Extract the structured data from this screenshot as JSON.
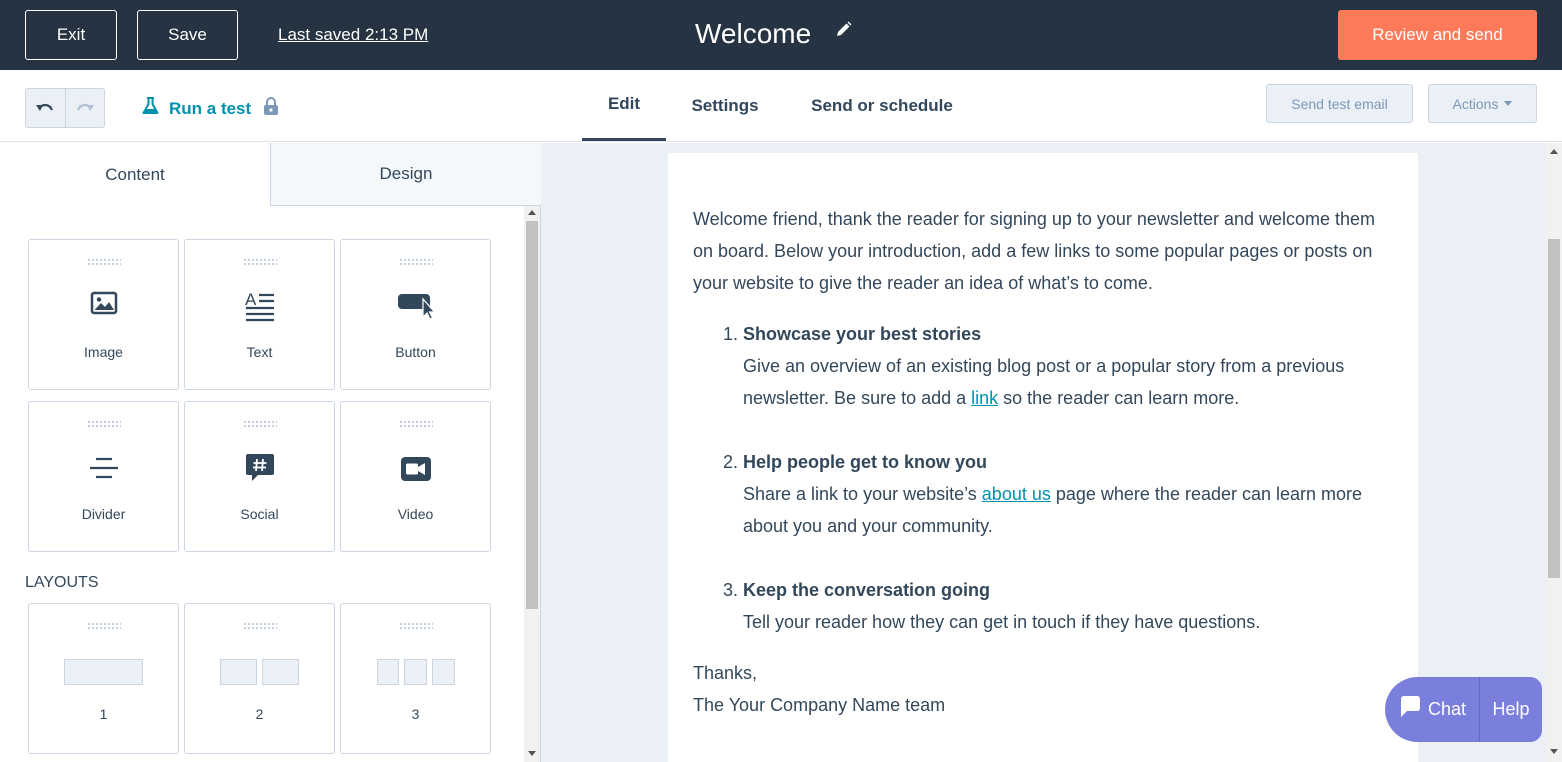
{
  "topbar": {
    "exit_label": "Exit",
    "save_label": "Save",
    "last_saved": "Last saved 2:13 PM",
    "title": "Welcome",
    "review_label": "Review and send",
    "accent_color": "#ff7a59",
    "bg_color": "#253342"
  },
  "subbar": {
    "run_test_label": "Run a test",
    "tabs": [
      "Edit",
      "Settings",
      "Send or schedule"
    ],
    "active_tab": "Edit",
    "send_test_label": "Send test email",
    "actions_label": "Actions"
  },
  "sidebar": {
    "panel_tabs": [
      "Content",
      "Design"
    ],
    "active_panel_tab": "Content",
    "modules": [
      {
        "label": "Image",
        "icon": "image-icon"
      },
      {
        "label": "Text",
        "icon": "text-icon"
      },
      {
        "label": "Button",
        "icon": "button-icon"
      },
      {
        "label": "Divider",
        "icon": "divider-icon"
      },
      {
        "label": "Social",
        "icon": "social-icon"
      },
      {
        "label": "Video",
        "icon": "video-icon"
      }
    ],
    "layouts_heading": "LAYOUTS",
    "layouts": [
      {
        "label": "1",
        "columns": 1
      },
      {
        "label": "2",
        "columns": 2
      },
      {
        "label": "3",
        "columns": 3
      }
    ]
  },
  "email": {
    "intro": "Welcome friend, thank the reader for signing up to your newsletter and welcome them on board. Below your introduction, add a few links to some popular pages or posts on your website to give the reader an idea of what’s to come.",
    "items": [
      {
        "title": "Showcase your best stories",
        "before": "Give an overview of an existing blog post or a popular story from a previous newsletter. Be sure to add a ",
        "link": "link",
        "after": " so the reader can learn more."
      },
      {
        "title": "Help people get to know you",
        "before": "Share a link to your website’s ",
        "link": "about us",
        "after": " page where the reader can learn more about you and your community."
      },
      {
        "title": "Keep the conversation going",
        "text": "Tell your reader how they can get in touch if they have questions."
      }
    ],
    "sign_off": "Thanks,",
    "signature": "The Your Company Name team"
  },
  "chat": {
    "chat_label": "Chat",
    "help_label": "Help",
    "color": "#7b7fdc"
  }
}
